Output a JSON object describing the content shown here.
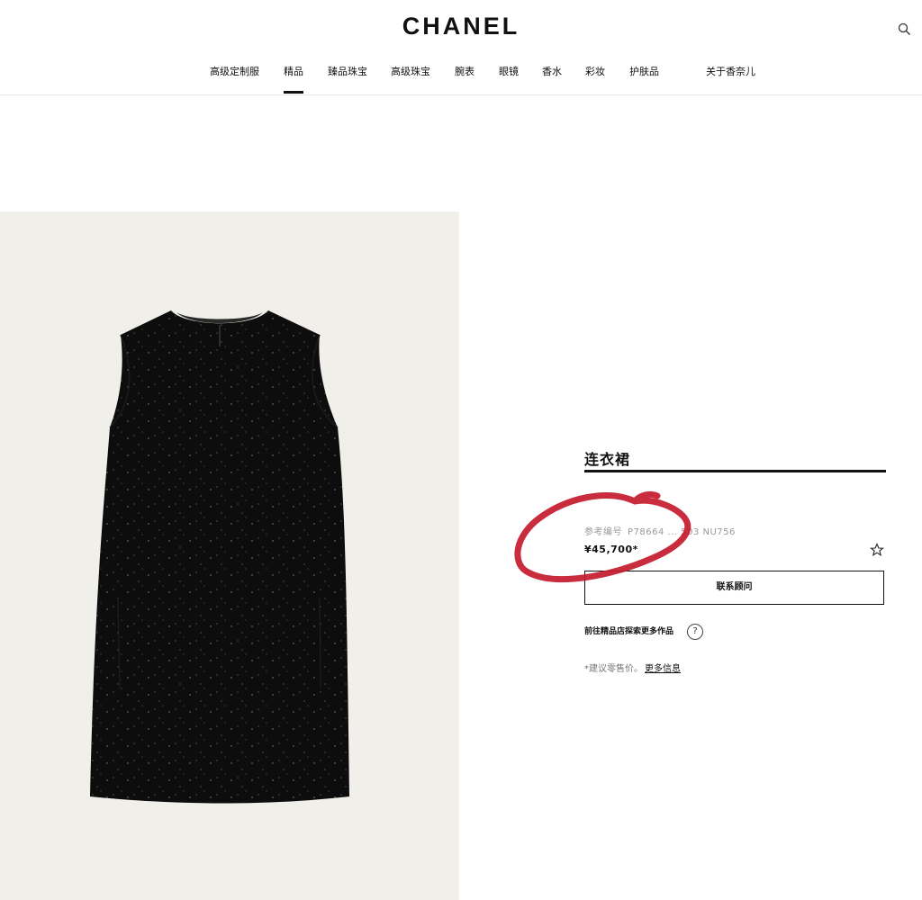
{
  "header": {
    "logo": "CHANEL",
    "nav": [
      {
        "label": "高级定制服",
        "active": false
      },
      {
        "label": "精品",
        "active": true
      },
      {
        "label": "臻品珠宝",
        "active": false
      },
      {
        "label": "高级珠宝",
        "active": false
      },
      {
        "label": "腕表",
        "active": false
      },
      {
        "label": "眼镜",
        "active": false
      },
      {
        "label": "香水",
        "active": false
      },
      {
        "label": "彩妆",
        "active": false
      },
      {
        "label": "护肤品",
        "active": false
      },
      {
        "label": "关于香奈儿",
        "active": false
      }
    ]
  },
  "product": {
    "title": "连衣裙",
    "ref_label": "参考编号",
    "ref_code": "P78664 ... 503 NU756",
    "price": "¥45,700*",
    "contact_label": "联系顾问",
    "boutique_label": "前往精品店探索更多作品",
    "help_glyph": "?",
    "note_text": "*建议零售价。",
    "note_link": "更多信息",
    "wishlist_glyph": "☆"
  },
  "icons": {
    "search": "search-icon",
    "wishlist": "star-icon",
    "help": "question-icon"
  },
  "colors": {
    "annotation": "#c41a2c",
    "image_background": "#f1efe9",
    "dress": "#0d0d0d"
  }
}
